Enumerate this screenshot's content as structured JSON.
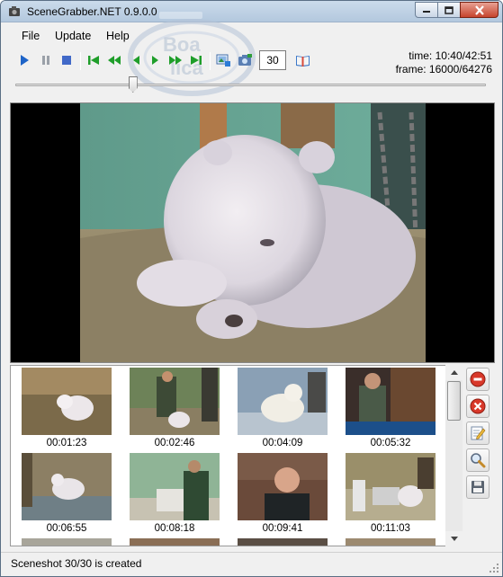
{
  "window": {
    "title": "SceneGrabber.NET 0.9.0.0"
  },
  "menu": {
    "items": [
      "File",
      "Update",
      "Help"
    ]
  },
  "toolbar": {
    "screenshot_count": "30",
    "time_text": "time: 10:40/42:51",
    "frame_text": "frame: 16000/64276"
  },
  "slider": {
    "position_fraction": 0.25
  },
  "thumbnails": [
    {
      "time": "00:01:23"
    },
    {
      "time": "00:02:46"
    },
    {
      "time": "00:04:09"
    },
    {
      "time": "00:05:32"
    },
    {
      "time": "00:06:55"
    },
    {
      "time": "00:08:18"
    },
    {
      "time": "00:09:41"
    },
    {
      "time": "00:11:03"
    }
  ],
  "status": {
    "text": "Sceneshot 30/30 is created"
  },
  "colors": {
    "play_blue": "#1e64c8",
    "nav_green": "#1f9e2a",
    "stop_blue": "#4169c8",
    "delete_red": "#d8382a"
  }
}
